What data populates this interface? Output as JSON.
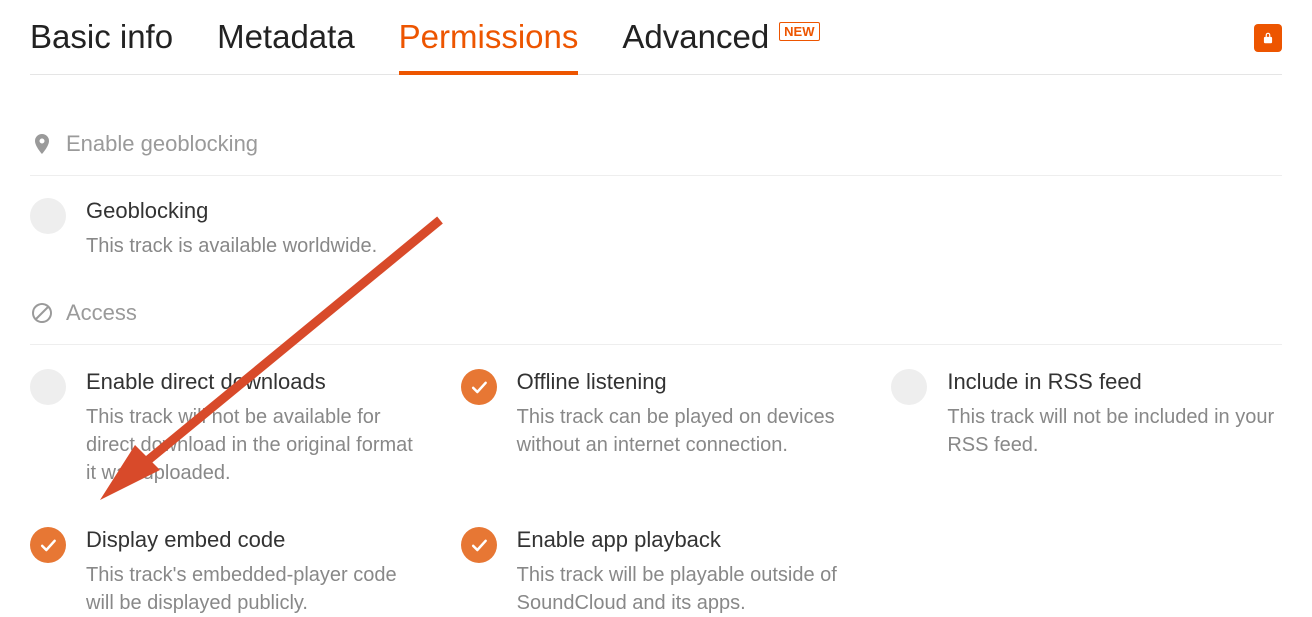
{
  "tabs": {
    "basic_info": "Basic info",
    "metadata": "Metadata",
    "permissions": "Permissions",
    "advanced": "Advanced",
    "new_badge": "NEW"
  },
  "geoblocking": {
    "section_title": "Enable geoblocking",
    "option_title": "Geoblocking",
    "option_desc": "This track is available worldwide."
  },
  "access": {
    "section_title": "Access",
    "items": [
      {
        "title": "Enable direct downloads",
        "desc": "This track will not be available for direct download in the original format it was uploaded.",
        "on": false
      },
      {
        "title": "Offline listening",
        "desc": "This track can be played on devices without an internet connection.",
        "on": true
      },
      {
        "title": "Include in RSS feed",
        "desc": "This track will not be included in your RSS feed.",
        "on": false
      },
      {
        "title": "Display embed code",
        "desc": "This track's embedded-player code will be displayed publicly.",
        "on": true
      },
      {
        "title": "Enable app playback",
        "desc": "This track will be playable outside of SoundCloud and its apps.",
        "on": true
      }
    ]
  },
  "colors": {
    "accent": "#ed5500",
    "toggle_on": "#e77734"
  }
}
